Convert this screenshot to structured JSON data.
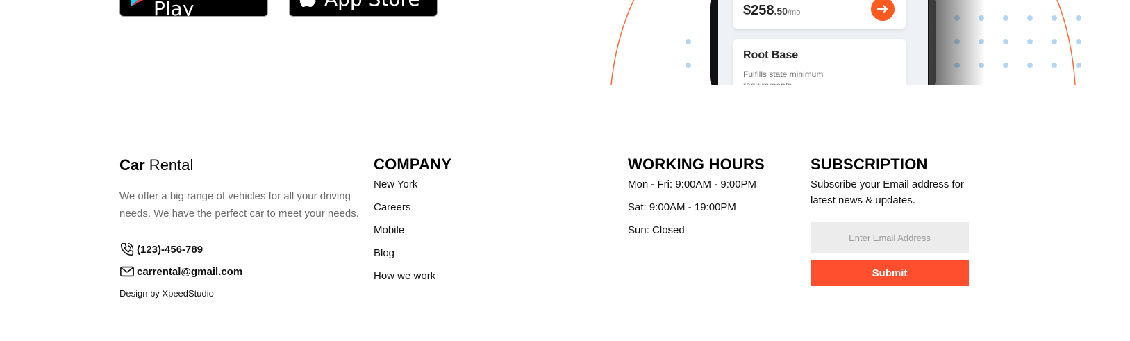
{
  "hero": {
    "google_play_label": "Google Play",
    "app_store_label": "App Store",
    "price": {
      "main": "$258",
      "cents": ".50",
      "unit": "/mo"
    },
    "plan": {
      "title": "Root Base",
      "description": "Fulfills state minimum requirements"
    }
  },
  "footer": {
    "brand": {
      "strong": "Car",
      "light": " Rental"
    },
    "about": "We offer a big range of vehicles for all your driving needs. We have the perfect car to meet your needs.",
    "phone": "(123)-456-789",
    "email": "carrental@gmail.com",
    "credit": "Design by XpeedStudio",
    "company": {
      "heading": "COMPANY",
      "links": [
        "New York",
        "Careers",
        "Mobile",
        "Blog",
        "How we work"
      ]
    },
    "hours": {
      "heading": "WORKING HOURS",
      "lines": [
        "Mon - Fri: 9:00AM - 9:00PM",
        "Sat: 9:00AM - 19:00PM",
        "Sun: Closed"
      ]
    },
    "subscription": {
      "heading": "SUBSCRIPTION",
      "description": "Subscribe your Email address for latest news & updates.",
      "placeholder": "Enter Email Address",
      "submit_label": "Submit"
    }
  },
  "colors": {
    "accent": "#ff4f2e",
    "dots": "#b5d6f3",
    "muted_text": "#6b6b6b"
  },
  "icons": [
    "google-play-icon",
    "apple-icon",
    "arrow-right-icon",
    "phone-icon",
    "mail-icon"
  ]
}
